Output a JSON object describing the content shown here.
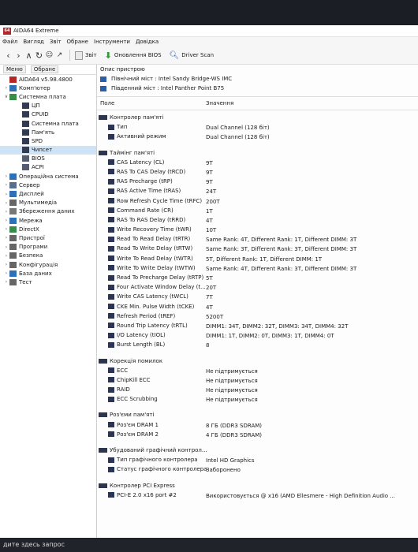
{
  "window": {
    "title": "AIDA64 Extreme"
  },
  "menu": [
    "Файл",
    "Вигляд",
    "Звіт",
    "Обране",
    "Інструменти",
    "Довідка"
  ],
  "toolbar": {
    "report": "Звіт",
    "bios_update": "Оновлення BIOS",
    "driver_scan": "Driver Scan"
  },
  "left_panel": {
    "tabs": [
      "Меню",
      "Обране"
    ],
    "tree": [
      {
        "label": "AIDA64 v5.98.4800",
        "level": 0,
        "expand": "",
        "icon": "aida-icon",
        "color": "#b3262a"
      },
      {
        "label": "Комп'ютер",
        "level": 0,
        "expand": ">",
        "icon": "computer-icon",
        "color": "#2f6fb8"
      },
      {
        "label": "Системна плата",
        "level": 0,
        "expand": "v",
        "icon": "motherboard-icon",
        "color": "#3a8a4a"
      },
      {
        "label": "ЦП",
        "level": 1,
        "expand": "",
        "icon": "cpu-icon",
        "color": "#333b52"
      },
      {
        "label": "CPUID",
        "level": 1,
        "expand": "",
        "icon": "cpuid-icon",
        "color": "#333b52"
      },
      {
        "label": "Системна плата",
        "level": 1,
        "expand": "",
        "icon": "board-icon",
        "color": "#333b52"
      },
      {
        "label": "Пам'ять",
        "level": 1,
        "expand": "",
        "icon": "memory-icon",
        "color": "#333b52"
      },
      {
        "label": "SPD",
        "level": 1,
        "expand": "",
        "icon": "spd-icon",
        "color": "#333b52"
      },
      {
        "label": "Чипсет",
        "level": 1,
        "expand": "",
        "icon": "chipset-icon",
        "color": "#333b52",
        "selected": true
      },
      {
        "label": "BIOS",
        "level": 1,
        "expand": "",
        "icon": "bios-icon",
        "color": "#555c70"
      },
      {
        "label": "ACPI",
        "level": 1,
        "expand": "",
        "icon": "acpi-icon",
        "color": "#555c70"
      },
      {
        "label": "Операційна система",
        "level": 0,
        "expand": ">",
        "icon": "os-icon",
        "color": "#2f6fb8"
      },
      {
        "label": "Сервер",
        "level": 0,
        "expand": ">",
        "icon": "server-icon",
        "color": "#5a6d8c"
      },
      {
        "label": "Дисплей",
        "level": 0,
        "expand": ">",
        "icon": "display-icon",
        "color": "#2f6fb8"
      },
      {
        "label": "Мультимедіа",
        "level": 0,
        "expand": ">",
        "icon": "multimedia-icon",
        "color": "#666"
      },
      {
        "label": "Збереження даних",
        "level": 0,
        "expand": ">",
        "icon": "storage-icon",
        "color": "#777"
      },
      {
        "label": "Мережа",
        "level": 0,
        "expand": ">",
        "icon": "network-icon",
        "color": "#2f6fb8"
      },
      {
        "label": "DirectX",
        "level": 0,
        "expand": ">",
        "icon": "directx-icon",
        "color": "#3a8a4a"
      },
      {
        "label": "Пристрої",
        "level": 0,
        "expand": ">",
        "icon": "devices-icon",
        "color": "#666"
      },
      {
        "label": "Програми",
        "level": 0,
        "expand": ">",
        "icon": "programs-icon",
        "color": "#666"
      },
      {
        "label": "Безпека",
        "level": 0,
        "expand": ">",
        "icon": "security-icon",
        "color": "#666"
      },
      {
        "label": "Конфігурація",
        "level": 0,
        "expand": ">",
        "icon": "config-icon",
        "color": "#666"
      },
      {
        "label": "База даних",
        "level": 0,
        "expand": ">",
        "icon": "database-icon",
        "color": "#2f6fb8"
      },
      {
        "label": "Тест",
        "level": 0,
        "expand": ">",
        "icon": "test-icon",
        "color": "#666"
      }
    ]
  },
  "device": {
    "header": "Опис пристрою",
    "items": [
      "Північний міст : Intel Sandy Bridge-WS IMC",
      "Південний міст : Intel Panther Point B75"
    ]
  },
  "columns": {
    "field": "Поле",
    "value": "Значення"
  },
  "sections": [
    {
      "title": "Контролер пам'яті",
      "items": [
        {
          "field": "Тип",
          "value": "Dual Channel (128 біт)"
        },
        {
          "field": "Активний режим",
          "value": "Dual Channel (128 біт)"
        }
      ]
    },
    {
      "title": "Таймінг пам'яті",
      "items": [
        {
          "field": "CAS Latency (CL)",
          "value": "9T"
        },
        {
          "field": "RAS To CAS Delay (tRCD)",
          "value": "9T"
        },
        {
          "field": "RAS Precharge (tRP)",
          "value": "9T"
        },
        {
          "field": "RAS Active Time (tRAS)",
          "value": "24T"
        },
        {
          "field": "Row Refresh Cycle Time (tRFC)",
          "value": "200T"
        },
        {
          "field": "Command Rate (CR)",
          "value": "1T"
        },
        {
          "field": "RAS To RAS Delay (tRRD)",
          "value": "4T"
        },
        {
          "field": "Write Recovery Time (tWR)",
          "value": "10T"
        },
        {
          "field": "Read To Read Delay (tRTR)",
          "value": "Same Rank: 4T, Different Rank: 1T, Different DIMM: 3T"
        },
        {
          "field": "Read To Write Delay (tRTW)",
          "value": "Same Rank: 3T, Different Rank: 3T, Different DIMM: 3T"
        },
        {
          "field": "Write To Read Delay (tWTR)",
          "value": "5T, Different Rank: 1T, Different DIMM: 1T"
        },
        {
          "field": "Write To Write Delay (tWTW)",
          "value": "Same Rank: 4T, Different Rank: 3T, Different DIMM: 3T"
        },
        {
          "field": "Read To Precharge Delay (tRTP)",
          "value": "5T"
        },
        {
          "field": "Four Activate Window Delay (t...",
          "value": "20T"
        },
        {
          "field": "Write CAS Latency (tWCL)",
          "value": "7T"
        },
        {
          "field": "CKE Min. Pulse Width (tCKE)",
          "value": "4T"
        },
        {
          "field": "Refresh Period (tREF)",
          "value": "5200T"
        },
        {
          "field": "Round Trip Latency (tRTL)",
          "value": "DIMM1: 34T, DIMM2: 32T, DIMM3: 34T, DIMM4: 32T"
        },
        {
          "field": "I/O Latency (tIOL)",
          "value": "DIMM1: 1T, DIMM2: 0T, DIMM3: 1T, DIMM4: 0T"
        },
        {
          "field": "Burst Length (BL)",
          "value": "8"
        }
      ]
    },
    {
      "title": "Корекція помилок",
      "items": [
        {
          "field": "ECC",
          "value": "Не підтримується"
        },
        {
          "field": "ChipKill ECC",
          "value": "Не підтримується"
        },
        {
          "field": "RAID",
          "value": "Не підтримується"
        },
        {
          "field": "ECC Scrubbing",
          "value": "Не підтримується"
        }
      ]
    },
    {
      "title": "Роз'єми пам'яті",
      "items": [
        {
          "field": "Роз'єм DRAM 1",
          "value": "8 ГБ (DDR3 SDRAM)"
        },
        {
          "field": "Роз'єм DRAM 2",
          "value": "4 ГБ (DDR3 SDRAM)"
        }
      ]
    },
    {
      "title": "Убудований графічний контрол...",
      "items": [
        {
          "field": "Тип графічного контролера",
          "value": "Intel HD Graphics"
        },
        {
          "field": "Статус графічного контролера",
          "value": "Заборонено"
        }
      ]
    },
    {
      "title": "Контролер PCI Express",
      "items": [
        {
          "field": "PCI-E 2.0 x16 port #2",
          "value": "Використовується @ x16  (AMD Ellesmere - High Definition Audio ..."
        }
      ]
    }
  ],
  "taskbar": {
    "search_placeholder": "дите здесь запрос"
  }
}
